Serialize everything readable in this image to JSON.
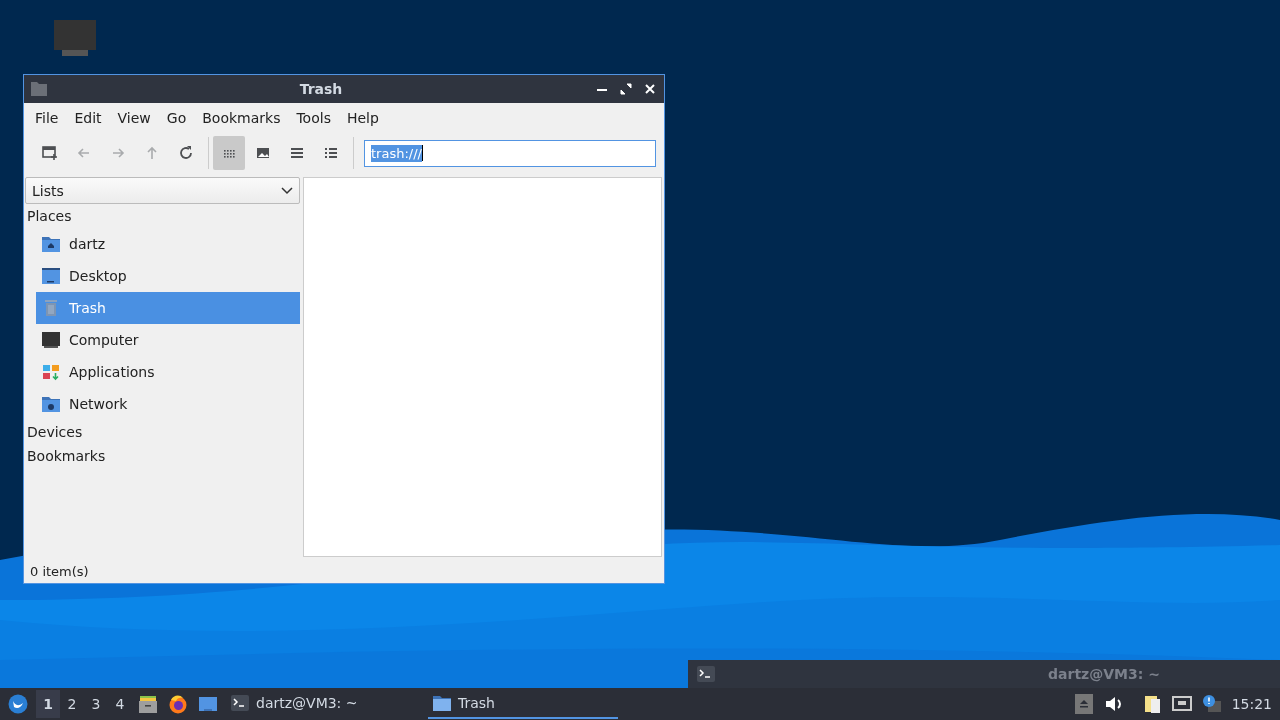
{
  "file_manager": {
    "title": "Trash",
    "menu": [
      "File",
      "Edit",
      "View",
      "Go",
      "Bookmarks",
      "Tools",
      "Help"
    ],
    "toolbar": [
      {
        "kind": "new-tab",
        "disabled": false,
        "selected": false
      },
      {
        "kind": "back",
        "disabled": true,
        "selected": false
      },
      {
        "kind": "forward",
        "disabled": true,
        "selected": false
      },
      {
        "kind": "up",
        "disabled": true,
        "selected": false
      },
      {
        "kind": "reload",
        "disabled": false,
        "selected": false
      },
      {
        "kind": "icon-view",
        "disabled": false,
        "selected": true
      },
      {
        "kind": "thumbnail-view",
        "disabled": false,
        "selected": false
      },
      {
        "kind": "compact-view",
        "disabled": false,
        "selected": false
      },
      {
        "kind": "detailed-view",
        "disabled": false,
        "selected": false
      }
    ],
    "location": {
      "value": "trash:///"
    },
    "side_pane": {
      "mode": "Lists",
      "sections": [
        {
          "label": "Places",
          "items": [
            {
              "label": "dartz",
              "kind": "home",
              "selected": false
            },
            {
              "label": "Desktop",
              "kind": "desktop",
              "selected": false
            },
            {
              "label": "Trash",
              "kind": "trash",
              "selected": true
            },
            {
              "label": "Computer",
              "kind": "computer",
              "selected": false
            },
            {
              "label": "Applications",
              "kind": "applications",
              "selected": false
            },
            {
              "label": "Network",
              "kind": "network",
              "selected": false
            }
          ]
        },
        {
          "label": "Devices"
        },
        {
          "label": "Bookmarks"
        }
      ]
    },
    "status_bar": "0 item(s)"
  },
  "terminal_window": {
    "title": "dartz@VM3: ~"
  },
  "taskbar": {
    "workspaces": [
      {
        "label": "1",
        "selected": true
      },
      {
        "label": "2",
        "selected": false
      },
      {
        "label": "3",
        "selected": false
      },
      {
        "label": "4",
        "selected": false
      }
    ],
    "launchers": [
      {
        "kind": "file-cabinet"
      },
      {
        "kind": "browser"
      },
      {
        "kind": "window"
      }
    ],
    "tasks": [
      {
        "label": "dartz@VM3: ~",
        "kind": "terminal",
        "selected": false
      },
      {
        "label": "Trash",
        "kind": "folder",
        "selected": true
      }
    ],
    "clock": "15:21"
  }
}
